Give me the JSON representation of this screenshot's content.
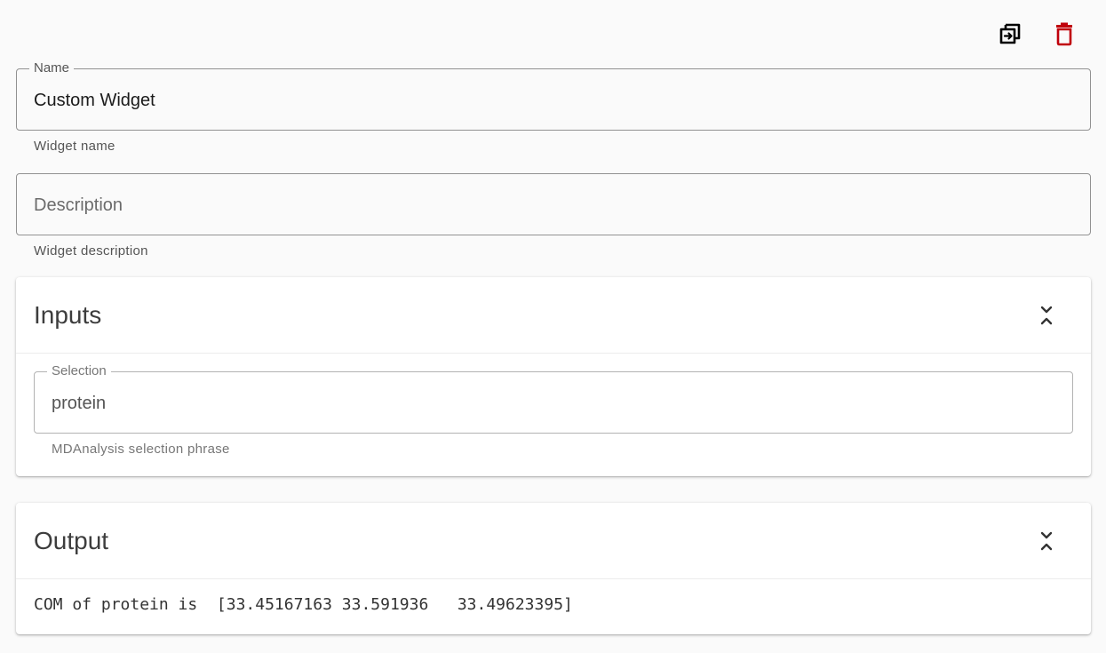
{
  "toolbar": {
    "copy_icon": "copy-to-icon",
    "delete_icon": "trash-icon",
    "delete_color": "#c0000b"
  },
  "name_field": {
    "label": "Name",
    "value": "Custom Widget",
    "hint": "Widget name"
  },
  "description_field": {
    "placeholder": "Description",
    "value": "",
    "hint": "Widget description"
  },
  "inputs_panel": {
    "title": "Inputs",
    "collapse_icon": "collapse-icon",
    "selection": {
      "label": "Selection",
      "value": "protein",
      "hint": "MDAnalysis selection phrase"
    }
  },
  "output_panel": {
    "title": "Output",
    "collapse_icon": "collapse-icon",
    "text": "COM of protein is  [33.45167163 33.591936   33.49623395]"
  }
}
